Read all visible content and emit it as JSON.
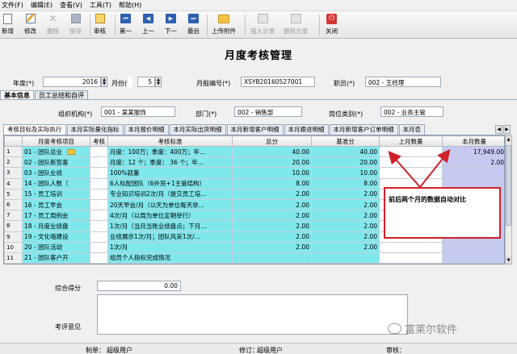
{
  "menu": [
    "文件(F)",
    "编辑(E)",
    "查看(V)",
    "工具(T)",
    "帮助(H)"
  ],
  "toolbar": {
    "new": "新增",
    "modify": "修改",
    "delete": "删除",
    "save": "保存",
    "audit": "审核",
    "first": "第一",
    "prev": "上一",
    "next": "下一",
    "last": "最后",
    "upload": "上传附件",
    "insert_row": "插入分录",
    "delete_row": "删除分录",
    "close": "关闭"
  },
  "page": {
    "title": "月度考核管理"
  },
  "header": {
    "year_label": "年度(*)",
    "year_value": "2016",
    "month_label": "月份(*)",
    "month_value": "5",
    "std_label": "考核标准",
    "report_no_label": "月报编号(*)",
    "report_no_value": "XSYB20160527001",
    "staff_label": "职员(*)",
    "staff_value": "002 - 王经理",
    "org_label": "组织机构(*)",
    "org_value": "001 - 某某服饰",
    "dept_label": "部门(*)",
    "dept_value": "002 - 销售部",
    "post_label": "岗位类别(*)",
    "post_value": "002 - 业务主管"
  },
  "main_tabs": [
    "基本信息",
    "员工总结和自评"
  ],
  "sub_tabs": [
    "考核目标及实际执行",
    "本月实际量化指标",
    "本月报价明细",
    "本月实际出货明细",
    "本月新增客户明细",
    "本月跟进明细",
    "本月新增客户订单明细",
    "本月否"
  ],
  "grid": {
    "columns": [
      "",
      "月度考核项目",
      "考核",
      "考核标准",
      "总分",
      "基准分",
      "上月数量",
      "本月数量"
    ],
    "rows": [
      {
        "n": "1",
        "item": "01 - 团队总业",
        "std": "月度：100万；季度：400万；年…",
        "total": "40.00",
        "base": "40.00",
        "last": "",
        "cur": "17,949.00"
      },
      {
        "n": "2",
        "item": "02 - 团队新签客",
        "std": "月度：12 个；季度： 36  个；年…",
        "total": "20.00",
        "base": "20.00",
        "last": "",
        "cur": "2.00"
      },
      {
        "n": "3",
        "item": "03 - 团队业绩",
        "std": "100%就董",
        "total": "10.00",
        "base": "10.00",
        "last": "",
        "cur": ""
      },
      {
        "n": "4",
        "item": "14 - 团队人数（",
        "std": "6人标配团队（6外贸+1主管结构）",
        "total": "8.00",
        "base": "8.00",
        "last": "",
        "cur": ""
      },
      {
        "n": "5",
        "item": "15 - 员工培训",
        "std": "专业知识培训2次/月（提交员工培…",
        "total": "2.00",
        "base": "2.00",
        "last": "",
        "cur": ""
      },
      {
        "n": "6",
        "item": "16 - 员工早会",
        "std": "20天早会/月（以天为单位每天举…",
        "total": "2.00",
        "base": "2.00",
        "last": "",
        "cur": ""
      },
      {
        "n": "7",
        "item": "17 - 员工周例会",
        "std": "4次/月（以周为单位定期举行）",
        "total": "2.00",
        "base": "2.00",
        "last": "",
        "cur": ""
      },
      {
        "n": "8",
        "item": "18 - 月度业绩盘",
        "std": "1次/月（当月当账业绩盘点；下月…",
        "total": "2.00",
        "base": "2.00",
        "last": "",
        "cur": ""
      },
      {
        "n": "9",
        "item": "19 - 文化墙建设",
        "std": "业绩展示1次/月；团队风采1次/…",
        "total": "2.00",
        "base": "2.00",
        "last": "",
        "cur": ""
      },
      {
        "n": "10",
        "item": "20 - 团队活动",
        "std": "1次/月",
        "total": "2.00",
        "base": "2.00",
        "last": "",
        "cur": ""
      },
      {
        "n": "11",
        "item": "21 - 团队客户开",
        "std": "组员个人指标完成情况",
        "total": "",
        "base": "",
        "last": "",
        "cur": ""
      }
    ]
  },
  "annotation": "前后两个月的数据自动对比",
  "summary": {
    "score_label": "综合得分",
    "score_value": "0.00",
    "comment_label": "考评意见"
  },
  "footer": {
    "maker_label": "制单：",
    "maker_value": "超级用户",
    "modifier_label": "修订：",
    "modifier_value": "超级用户",
    "auditor_label": "审核："
  },
  "watermark": "富莱尔软件",
  "colors": {
    "cyan_cell": "#7fe8ec",
    "blue_cell": "#c6caf2",
    "callout_border": "#d0202a"
  }
}
